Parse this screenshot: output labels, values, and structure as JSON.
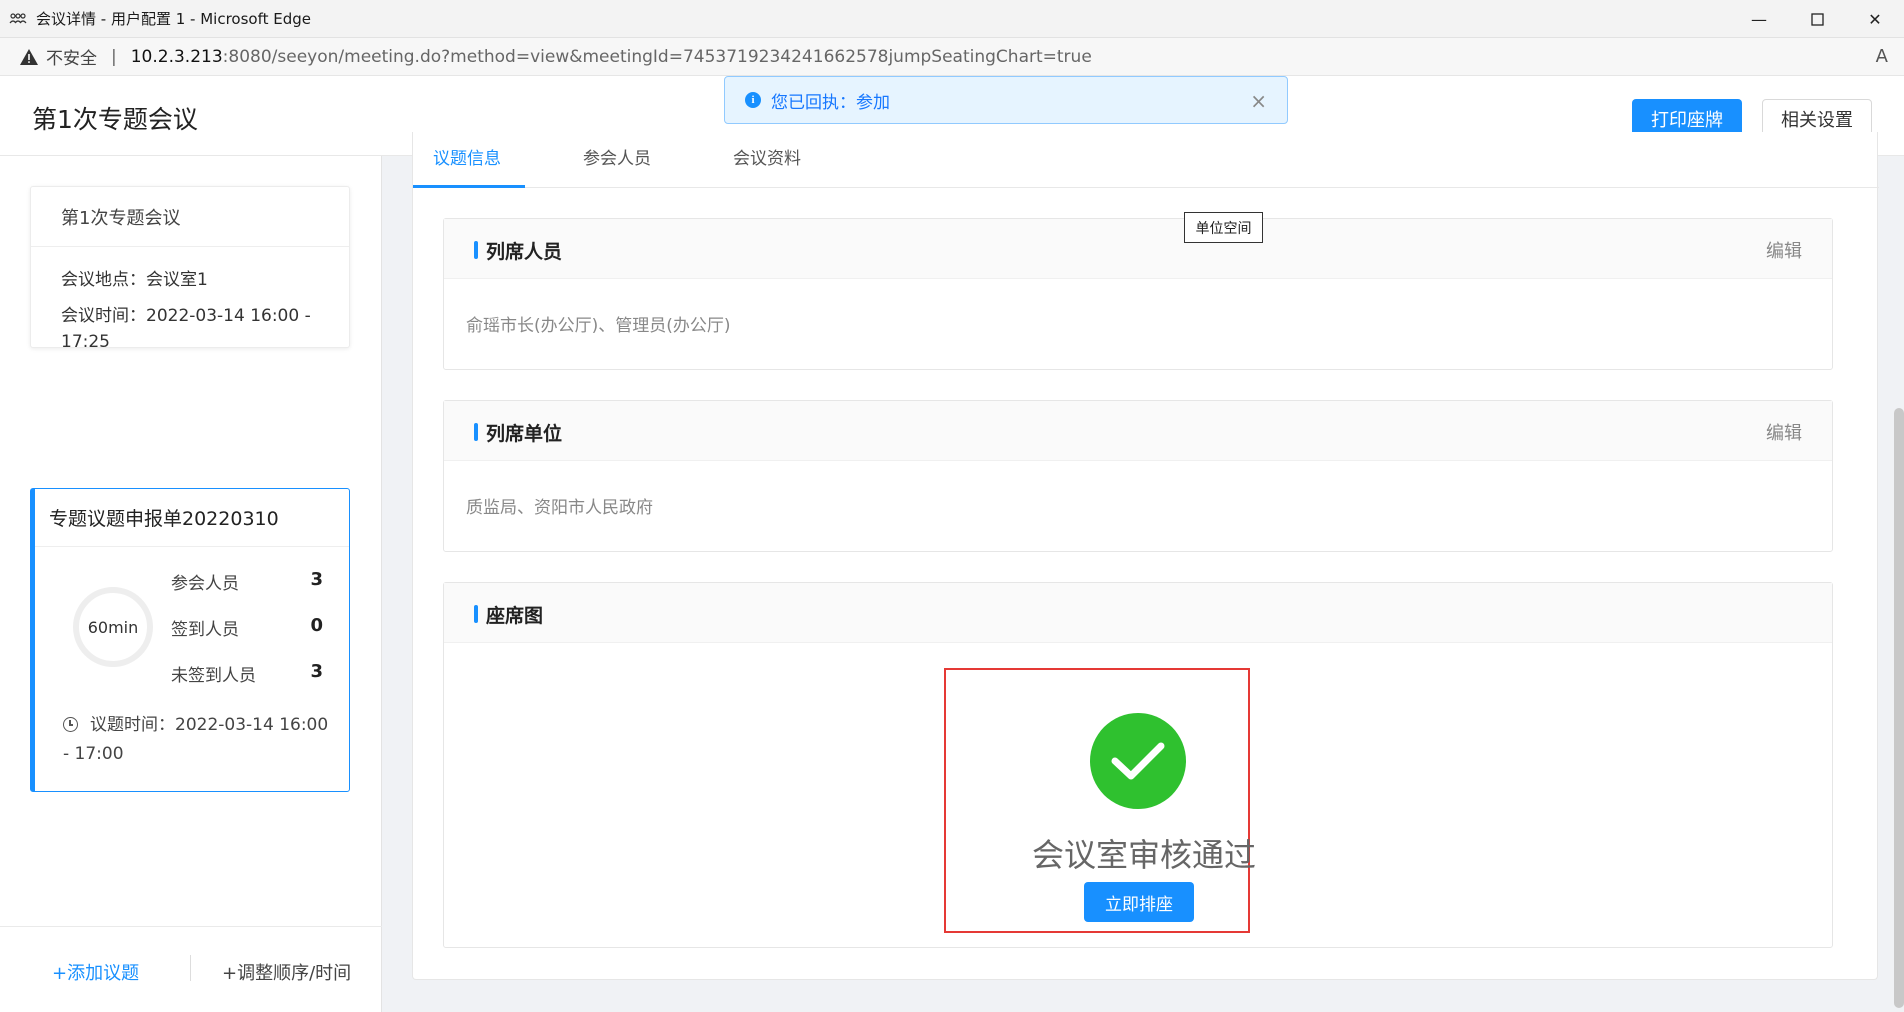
{
  "window": {
    "title": "会议详情 - 用户配置 1 - Microsoft Edge"
  },
  "address_bar": {
    "security": "不安全",
    "separator": "|",
    "url_host": "10.2.3.213",
    "url_rest": ":8080/seeyon/meeting.do?method=view&meetingId=7453719234241662578jumpSeatingChart=true",
    "read_aloud": "A"
  },
  "header": {
    "title": "第1次专题会议",
    "print_button": "打印座牌",
    "settings_button": "相关设置"
  },
  "toast": {
    "message": "您已回执：参加",
    "close": "×"
  },
  "sidebar": {
    "meeting_card": {
      "title": "第1次专题会议",
      "location": "会议地点：会议室1",
      "time": "会议时间：2022-03-14 16:00 - 17:25"
    },
    "agenda_card": {
      "title": "专题议题申报单20220310",
      "duration": "60min",
      "stats": [
        {
          "label": "参会人员",
          "value": "3"
        },
        {
          "label": "签到人员",
          "value": "0"
        },
        {
          "label": "未签到人员",
          "value": "3"
        }
      ],
      "agenda_time": "议题时间：2022-03-14 16:00 - 17:00"
    },
    "footer": {
      "add_agenda": "+添加议题",
      "adjust": "+调整顺序/时间"
    }
  },
  "main": {
    "tabs": [
      {
        "label": "议题信息",
        "active": true
      },
      {
        "label": "参会人员",
        "active": false
      },
      {
        "label": "会议资料",
        "active": false
      }
    ],
    "tooltip": "单位空间",
    "sections": [
      {
        "title": "列席人员",
        "edit": "编辑",
        "content": "俞瑶市长(办公厅)、管理员(办公厅)"
      },
      {
        "title": "列席单位",
        "edit": "编辑",
        "content": "质监局、资阳市人民政府"
      },
      {
        "title": "座席图"
      }
    ],
    "seating": {
      "status_text": "会议室审核通过",
      "arrange_button": "立即排座"
    }
  },
  "colors": {
    "primary": "#1890ff",
    "success": "#2fc12f",
    "highlight_border": "#e53935"
  }
}
